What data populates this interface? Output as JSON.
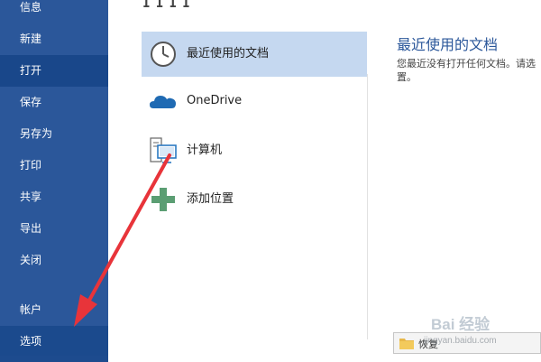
{
  "nav": {
    "items": [
      {
        "label": "信息"
      },
      {
        "label": "新建"
      },
      {
        "label": "打开"
      },
      {
        "label": "保存"
      },
      {
        "label": "另存为"
      },
      {
        "label": "打印"
      },
      {
        "label": "共享"
      },
      {
        "label": "导出"
      },
      {
        "label": "关闭"
      },
      {
        "label": "帐户"
      },
      {
        "label": "选项"
      }
    ]
  },
  "header": {
    "title_fragment": "ɿɿɿɿ"
  },
  "places": [
    {
      "label": "最近使用的文档",
      "icon": "clock-icon"
    },
    {
      "label": "OneDrive",
      "icon": "cloud-icon"
    },
    {
      "label": "计算机",
      "icon": "computer-icon"
    },
    {
      "label": "添加位置",
      "icon": "plus-icon"
    }
  ],
  "right_panel": {
    "title": "最近使用的文档",
    "text": "您最近没有打开任何文档。请选置。"
  },
  "recover_button": {
    "label": "恢复"
  },
  "watermark": {
    "text": "Bai 经验",
    "url": "jingyan.baidu.com"
  },
  "colors": {
    "nav_bg": "#2b579a",
    "accent": "#2b579a",
    "selected": "#c5d8f0",
    "arrow": "#e8343a"
  }
}
